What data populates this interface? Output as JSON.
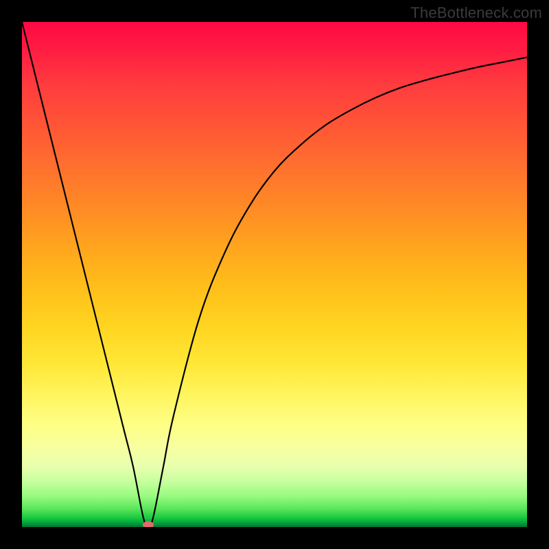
{
  "watermark": "TheBottleneck.com",
  "chart_data": {
    "type": "line",
    "title": "",
    "xlabel": "",
    "ylabel": "",
    "xlim": [
      0,
      100
    ],
    "ylim": [
      0,
      100
    ],
    "grid": false,
    "legend": false,
    "series": [
      {
        "name": "bottleneck-curve",
        "x": [
          0,
          5,
          10,
          15,
          20,
          22,
          24,
          25,
          26,
          28,
          30,
          35,
          40,
          45,
          50,
          55,
          60,
          65,
          70,
          75,
          80,
          85,
          90,
          95,
          100
        ],
        "y": [
          100,
          80,
          60,
          40,
          20,
          12,
          2,
          0,
          2,
          12,
          22,
          41,
          54,
          63.5,
          70.5,
          75.5,
          79.5,
          82.5,
          85,
          87,
          88.5,
          89.8,
          91,
          92,
          93
        ]
      }
    ],
    "marker": {
      "x": 25,
      "y": 0
    }
  }
}
